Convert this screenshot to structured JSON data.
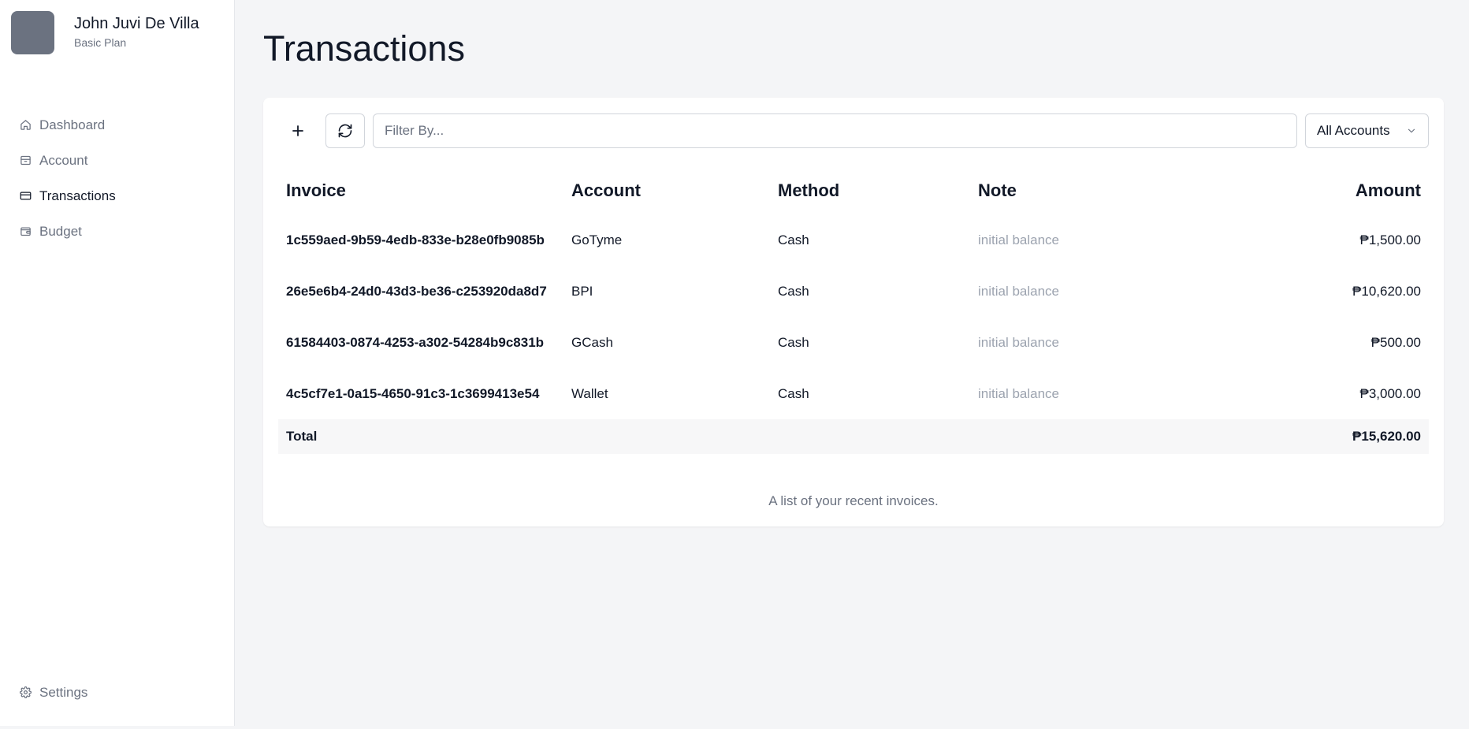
{
  "user": {
    "name": "John Juvi De Villa",
    "plan": "Basic Plan"
  },
  "nav": {
    "items": [
      {
        "label": "Dashboard",
        "icon": "home-icon"
      },
      {
        "label": "Account",
        "icon": "archive-icon"
      },
      {
        "label": "Transactions",
        "icon": "credit-card-icon"
      },
      {
        "label": "Budget",
        "icon": "wallet-icon"
      }
    ],
    "active": "Transactions",
    "settings_label": "Settings"
  },
  "page": {
    "title": "Transactions"
  },
  "toolbar": {
    "add_icon": "plus-icon",
    "refresh_icon": "refresh-icon",
    "filter_placeholder": "Filter By...",
    "account_filter": "All Accounts"
  },
  "table": {
    "columns": [
      "Invoice",
      "Account",
      "Method",
      "Note",
      "Amount"
    ],
    "rows": [
      {
        "invoice": "1c559aed-9b59-4edb-833e-b28e0fb9085b",
        "account": "GoTyme",
        "method": "Cash",
        "note": "initial balance",
        "amount": "₱1,500.00"
      },
      {
        "invoice": "26e5e6b4-24d0-43d3-be36-c253920da8d7",
        "account": "BPI",
        "method": "Cash",
        "note": "initial balance",
        "amount": "₱10,620.00"
      },
      {
        "invoice": "61584403-0874-4253-a302-54284b9c831b",
        "account": "GCash",
        "method": "Cash",
        "note": "initial balance",
        "amount": "₱500.00"
      },
      {
        "invoice": "4c5cf7e1-0a15-4650-91c3-1c3699413e54",
        "account": "Wallet",
        "method": "Cash",
        "note": "initial balance",
        "amount": "₱3,000.00"
      }
    ],
    "total_label": "Total",
    "total_amount": "₱15,620.00",
    "caption": "A list of your recent invoices."
  },
  "colors": {
    "sidebar_bg": "#ffffff",
    "page_bg": "#f4f5f7",
    "avatar": "#6b7280",
    "muted_text": "#9ca3af"
  }
}
